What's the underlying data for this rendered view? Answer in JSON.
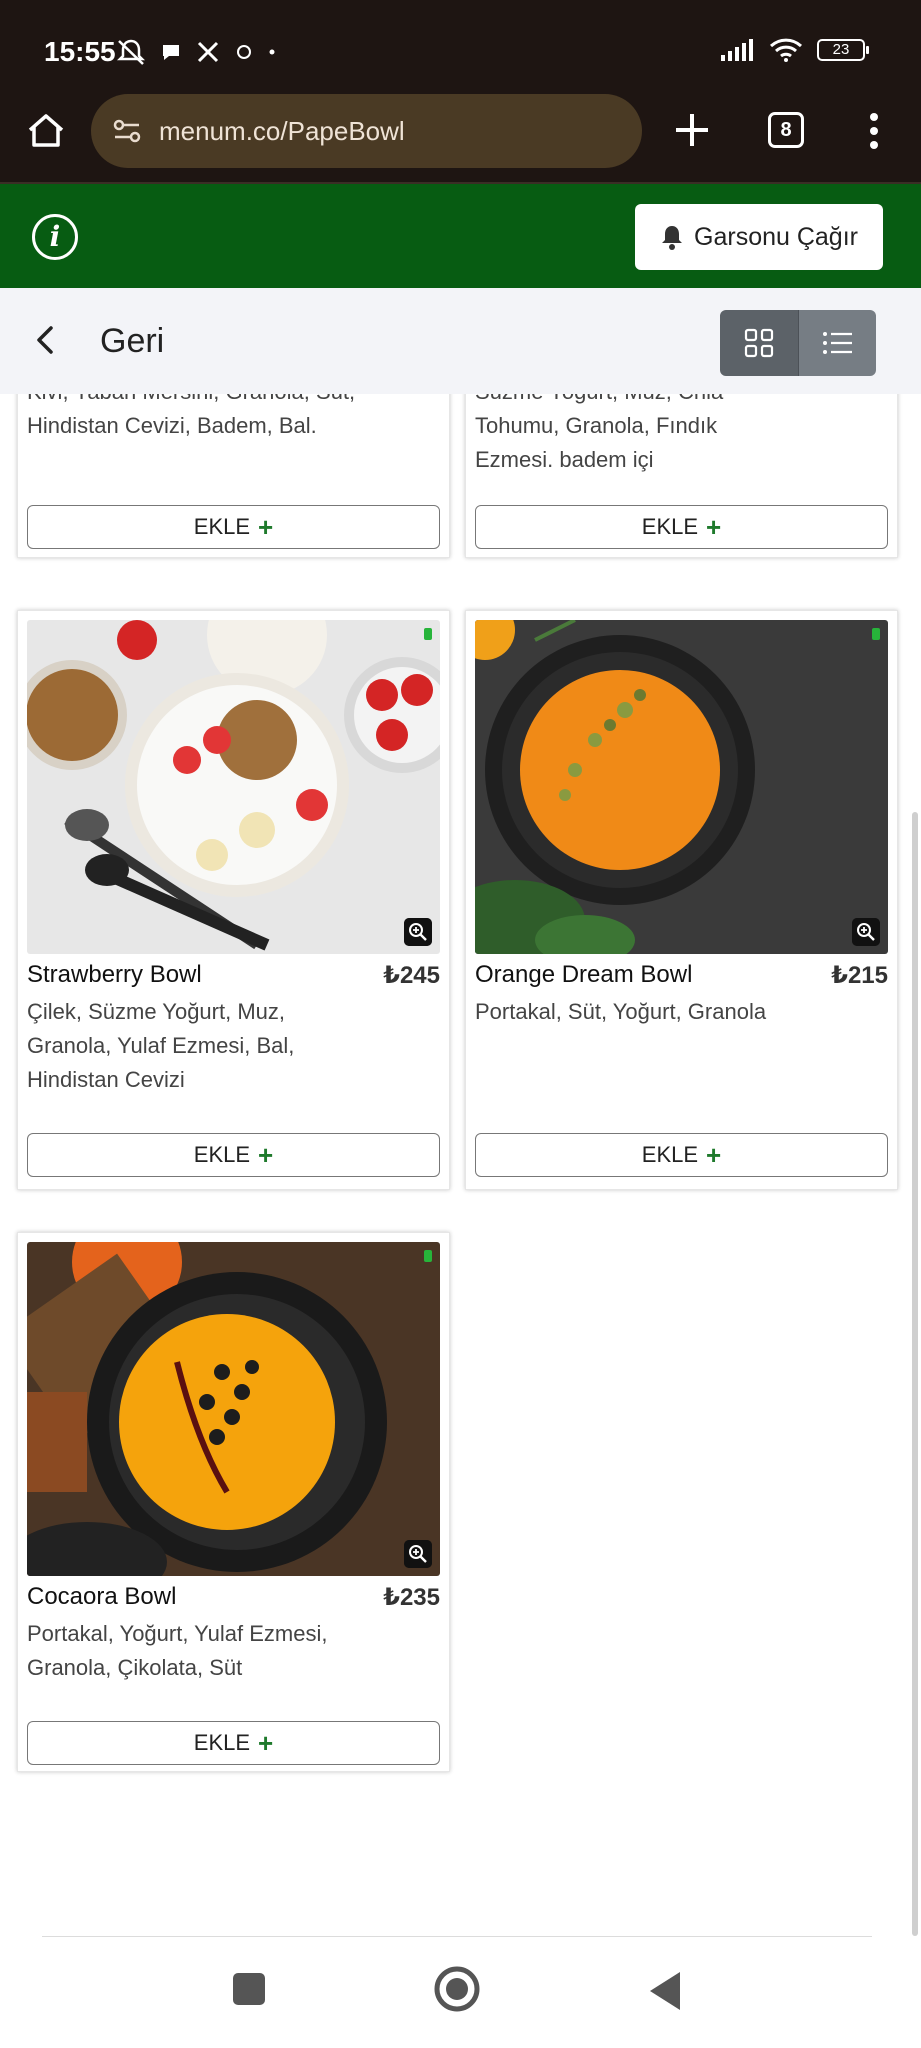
{
  "status_bar": {
    "time": "15:55",
    "battery": "23"
  },
  "browser": {
    "url": "menum.co/PapeBowl",
    "tab_count": "8"
  },
  "header": {
    "waiter_button": "Garsonu Çağır"
  },
  "nav": {
    "back_label": "Geri"
  },
  "cards_top": [
    {
      "desc": "Kivi, Yaban Mersini, Granola, Süt, Hindistan Cevizi, Badem, Bal.",
      "add_label": "EKLE"
    },
    {
      "desc": "Süzme Yoğurt, Muz, Chia Tohumu, Granola, Fındık Ezmesi. badem içi",
      "add_label": "EKLE"
    }
  ],
  "products": [
    {
      "name": "Strawberry Bowl",
      "price": "₺245",
      "desc": "Çilek, Süzme Yoğurt, Muz, Granola, Yulaf Ezmesi, Bal, Hindistan Cevizi",
      "add_label": "EKLE"
    },
    {
      "name": "Orange Dream Bowl",
      "price": "₺215",
      "desc": "Portakal, Süt, Yoğurt, Granola",
      "add_label": "EKLE"
    },
    {
      "name": "Cocaora Bowl",
      "price": "₺235",
      "desc": "Portakal, Yoğurt, Yulaf Ezmesi, Granola, Çikolata, Süt",
      "add_label": "EKLE"
    }
  ],
  "colors": {
    "header_green": "#075c12",
    "browser_bg": "#1e1512",
    "url_bg": "#4a3a24",
    "add_plus": "#1f7a2c"
  }
}
